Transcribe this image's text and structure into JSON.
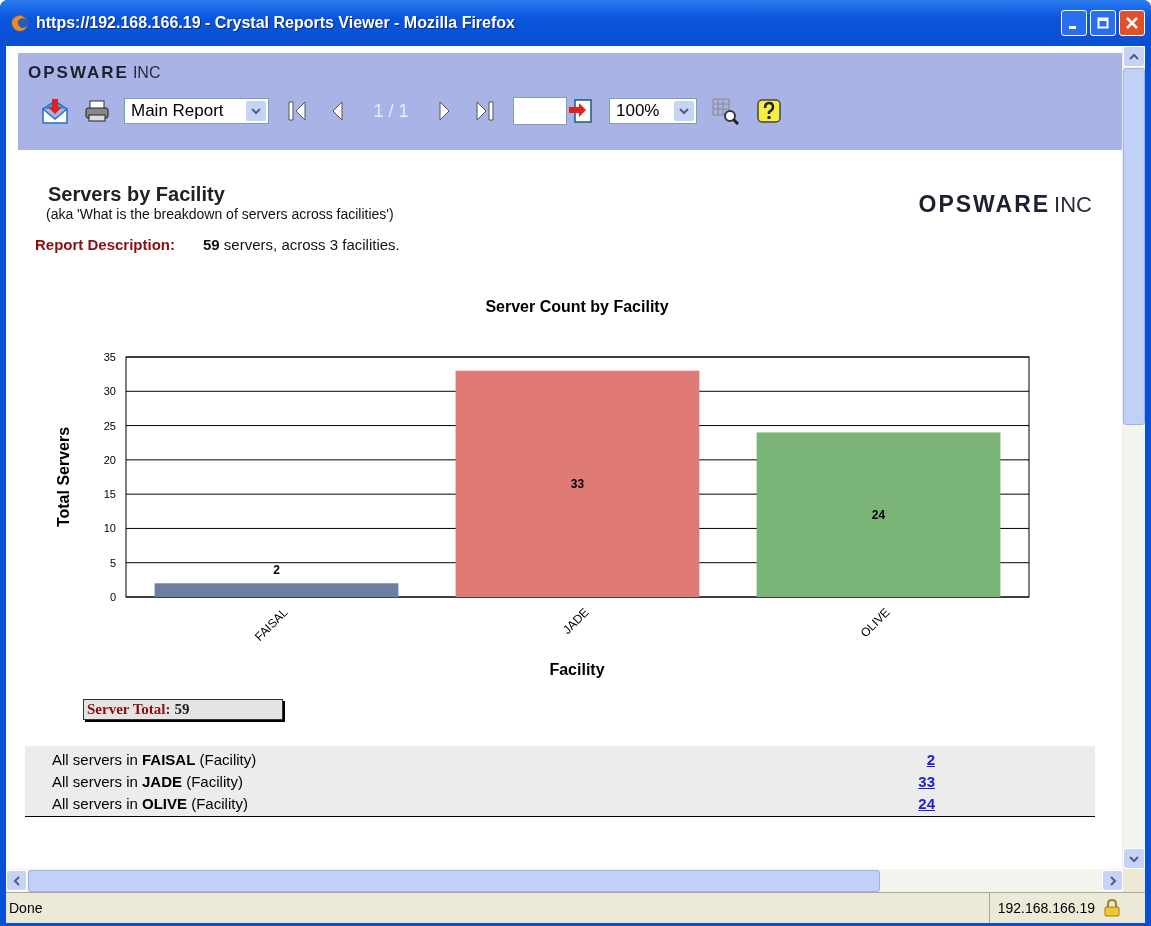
{
  "window": {
    "title": "https://192.168.166.19 - Crystal Reports Viewer - Mozilla Firefox"
  },
  "toolbar": {
    "logo": {
      "name": "OPSWARE",
      "suffix": "INC"
    },
    "report_select": "Main Report",
    "page": "1 / 1",
    "zoom": "100%"
  },
  "report": {
    "title": "Servers by Facility",
    "subtitle": "(aka 'What is the breakdown of servers across facilities')",
    "logo": {
      "name": "OPSWARE",
      "suffix": "INC"
    },
    "description_label": "Report Description:",
    "description": "**59** servers, across 3 facilities.",
    "chart_data": {
      "type": "bar",
      "title": "Server Count by Facility",
      "xlabel": "Facility",
      "ylabel": "Total Servers",
      "categories": [
        "FAISAL",
        "JADE",
        "OLIVE"
      ],
      "values": [
        2,
        33,
        24
      ],
      "grid": true,
      "colors": [
        "#6b7fa5",
        "#e07a74",
        "#7ab476"
      ],
      "ylim": [
        0,
        35
      ],
      "yticks": [
        0,
        5,
        10,
        15,
        20,
        25,
        30,
        35
      ],
      "data_labels": true
    },
    "total_label": "Server Total:",
    "total_value": "59",
    "rows": [
      {
        "text": "All servers in **FAISAL** (Facility)",
        "count": "2"
      },
      {
        "text": "All servers in **JADE** (Facility)",
        "count": "33"
      },
      {
        "text": "All servers in **OLIVE** (Facility)",
        "count": "24"
      }
    ]
  },
  "status_bar": {
    "text": "Done",
    "address": "192.168.166.19"
  }
}
